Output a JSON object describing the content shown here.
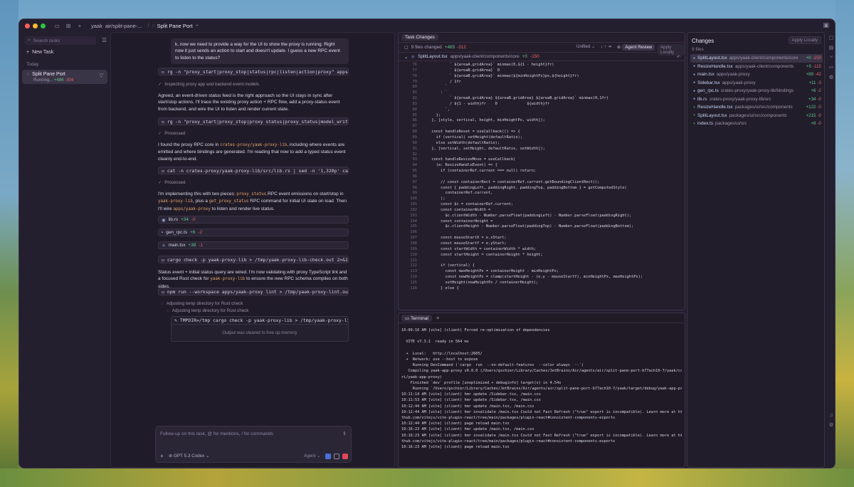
{
  "titlebar": {
    "project": "yaak",
    "branch": "air/split-pane-...",
    "sep": "/",
    "task_title": "Split Pane Port"
  },
  "sidebar": {
    "search_placeholder": "Search tasks",
    "new_task": "New Task",
    "section": "Today",
    "task": {
      "title": "Split Pane Port",
      "status": "Running...",
      "additions": "+486",
      "deletions": "-304"
    }
  },
  "chat": {
    "user_message": "k, now we need to provide a way for the UI to show the proxy is running. Right now it just sends an action to start and doesn't update. I guess a new RPC event to listen to the status?",
    "cmd1": "rg -n \"proxy_start|proxy_stop|status|rpc|listen|action|proxy\" apps/yaak-proxy -g \"!*.ts...",
    "status1": "Inspecting proxy app and backend event models",
    "para1": "Agreed, an event-driven status feed is the right approach so the UI stays in sync after start/stop actions. I'll trace the existing proxy action + RPC flow, add a proxy-status event from backend, and wire the UI to listen and render current state.",
    "cmd2": "rg -n \"proxy_start|proxy_stop|proxy status|proxy_status|model_write|emit|listen|rpc\" ...",
    "status2": "Processed",
    "para2_a": "I found the proxy RPC core in ",
    "para2_code": "crates-proxy/yaak-proxy-lib",
    "para2_b": ", including where events are emitted and where bindings are generated. I'm reading that now to add a typed status event cleanly end-to-end.",
    "cmd3": "cat -n crates-proxy/yaak-proxy-lib/src/lib.rs | sed -n '1,320p' cat -n crates-proxy/ya...",
    "status3": "Processed",
    "para3_a": "I'm implementing this with two pieces: ",
    "para3_code1": "proxy_status",
    "para3_b": " RPC event emissions on start/stop in ",
    "para3_code2": "yaak-proxy-lib",
    "para3_c": ", plus a ",
    "para3_code3": "get_proxy_status",
    "para3_d": " RPC command for initial UI state on load. Then I'll wire ",
    "para3_code4": "apps/yaak-proxy",
    "para3_e": " to listen and render live status.",
    "files": [
      {
        "name": "lib.rs",
        "add": "+34",
        "del": "-0"
      },
      {
        "name": "gen_rpc.ts",
        "add": "+6",
        "del": "-2"
      },
      {
        "name": "main.tsx",
        "add": "+38",
        "del": "-1"
      }
    ],
    "cmd4": "cargo check -p yaak-proxy-lib > /tmp/yaak-proxy-lib-check.out 2>&1; echo exit:$?; s...",
    "para4_a": "Status event + initial status query are wired. I'm now validating with proxy TypeScript lint and a focused Rust check for ",
    "para4_code": "yaak-proxy-lib",
    "para4_b": " to ensure the new RPC schema compiles on both sides.",
    "cmd5": "npm run --workspace apps/yaak-proxy lint > /tmp/yaak-proxy-lint.out 2>&1; echo exi...",
    "spin1": "Adjusting temp directory for Rust check",
    "spin2": "Adjusting temp directory for Rust check",
    "output_cmd": "TMPDIR=/tmp cargo check -p yaak-proxy-lib > /tmp/yaak-proxy-lib-check.out...",
    "output_msg": "Output was cleared to free up memory",
    "composer_placeholder": "Follow-up on this task, @ for mentions, / for commands",
    "model": "GPT 5.3 Codex",
    "mode": "Agent"
  },
  "task_changes": {
    "tab": "Task Changes",
    "files_changed": "9 files changed",
    "additions": "+485",
    "deletions": "-312",
    "view": "Unified",
    "agent_review": "Agent Review",
    "apply_locally": "Apply Locally",
    "file": "SplitLayout.tsx",
    "file_path": "apps/yaak-client/components/core",
    "file_add": "+0",
    "file_del": "-150",
    "code": [
      {
        "ln": "76",
        "tx": "          ` ${areaA.gridArea}` minmax(0,${1 - height}fr)"
      },
      {
        "ln": "77",
        "tx": "          ` ${areaB.gridArea}` 0"
      },
      {
        "ln": "78",
        "tx": "          ` ${areaB.gridArea}` minmax(${minHeightPx}px,${height}fr)"
      },
      {
        "ln": "79",
        "tx": "          / 1fr"
      },
      {
        "ln": "80",
        "tx": "        `"
      },
      {
        "ln": "81",
        "tx": "      : `"
      },
      {
        "ln": "82",
        "tx": "          ` ${areaA.gridArea} ${areaB.gridArea} ${areaB.gridArea}` minmax(0,1fr)"
      },
      {
        "ln": "83",
        "tx": "          / ${1 - width}fr    0             ${width}fr"
      },
      {
        "ln": "84",
        "tx": "        `,"
      },
      {
        "ln": "85",
        "tx": "    };"
      },
      {
        "ln": "86",
        "tx": "  }, [style, vertical, height, minHeightPx, width]);"
      },
      {
        "ln": "87",
        "tx": ""
      },
      {
        "ln": "88",
        "tx": "  const handleReset = useCallback(() => {"
      },
      {
        "ln": "89",
        "tx": "    if (vertical) setHeight(defaultRatio);"
      },
      {
        "ln": "90",
        "tx": "    else setWidth(defaultRatio);"
      },
      {
        "ln": "91",
        "tx": "  }, [vertical, setHeight, defaultRatio, setWidth]);"
      },
      {
        "ln": "92",
        "tx": ""
      },
      {
        "ln": "93",
        "tx": "  const handleResizeMove = useCallback("
      },
      {
        "ln": "94",
        "tx": "    (e: ResizeHandleEvent) => {"
      },
      {
        "ln": "95",
        "tx": "      if (containerRef.current === null) return;"
      },
      {
        "ln": "96",
        "tx": ""
      },
      {
        "ln": "97",
        "tx": "      // const containerRect = containerRef.current.getBoundingClientRect();"
      },
      {
        "ln": "98",
        "tx": "      const { paddingLeft, paddingRight, paddingTop, paddingBottom } = getComputedStyle("
      },
      {
        "ln": "99",
        "tx": "        containerRef.current,"
      },
      {
        "ln": "100",
        "tx": "      );"
      },
      {
        "ln": "101",
        "tx": "      const $c = containerRef.current;"
      },
      {
        "ln": "102",
        "tx": "      const containerWidth ="
      },
      {
        "ln": "103",
        "tx": "        $c.clientWidth - Number.parseFloat(paddingLeft) - Number.parseFloat(paddingRight);"
      },
      {
        "ln": "104",
        "tx": "      const containerHeight ="
      },
      {
        "ln": "105",
        "tx": "        $c.clientHeight - Number.parseFloat(paddingTop) - Number.parseFloat(paddingBottom);"
      },
      {
        "ln": "106",
        "tx": ""
      },
      {
        "ln": "107",
        "tx": "      const mouseStartX = e.xStart;"
      },
      {
        "ln": "108",
        "tx": "      const mouseStartY = e.yStart;"
      },
      {
        "ln": "109",
        "tx": "      const startWidth = containerWidth * width;"
      },
      {
        "ln": "110",
        "tx": "      const startHeight = containerHeight * height;"
      },
      {
        "ln": "111",
        "tx": ""
      },
      {
        "ln": "112",
        "tx": "      if (vertical) {"
      },
      {
        "ln": "113",
        "tx": "        const maxHeightPx = containerHeight - minHeightPx;"
      },
      {
        "ln": "114",
        "tx": "        const newHeightPx = clamp(startHeight - (e.y - mouseStartY), minHeightPx, maxHeightPx);"
      },
      {
        "ln": "115",
        "tx": "        setHeight(newHeightPx / containerHeight);"
      },
      {
        "ln": "116",
        "tx": "      } else {"
      }
    ]
  },
  "terminal": {
    "tab": "Terminal",
    "add": "+",
    "lines": [
      "10:09:10 AM [vite] (client) Forced re-optimization of dependencies",
      "",
      "  VITE v7.3.1  ready in 564 ms",
      "",
      "  ➜  Local:   http://localhost:2605/",
      "  ➜  Network: use --host to expose",
      "     Running DevCommand (`cargo  run  --no-default-features  --color always  --`)",
      "   Compiling yaak-app-proxy v0.0.0 (/Users/gschier/Library/Caches/JetBrains/Air/agents/air/split-pane-port-b77ach10-7/yaak/crates-tau",
      "ri/yaak-app-proxy)",
      "    Finished `dev` profile [unoptimized + debuginfo] target(s) in 4.54s",
      "     Running `/Users/gschier/Library/Caches/JetBrains/Air/agents/air/split-pane-port-b77ach10-7/yaak/target/debug/yaak-app-proxy`",
      "10:11:14 AM [vite] (client) hmr update /Sidebar.tsx, /main.css",
      "10:11:53 AM [vite] (client) hmr update /Sidebar.tsx, /main.css",
      "10:12:44 AM [vite] (client) hmr update /main.tsx, /main.css",
      "10:12:44 AM [vite] (client) hmr invalidate /main.tsx Could not Fast Refresh (\"true\" export is incompatible). Learn more at https://gi",
      "thub.com/vitejs/vite-plugin-react/tree/main/packages/plugin-react#consistent-components-exports",
      "10:12:44 AM [vite] (client) page reload main.tsx",
      "10:16:23 AM [vite] (client) hmr update /main.tsx, /main.css",
      "10:16:23 AM [vite] (client) hmr invalidate /main.tsx Could not Fast Refresh (\"true\" export is incompatible). Learn more at https://gi",
      "thub.com/vitejs/vite-plugin-react/tree/main/packages/plugin-react#consistent-components-exports",
      "10:16:23 AM [vite] (client) page reload main.tsx"
    ]
  },
  "changes": {
    "title": "Changes",
    "apply": "Apply Locally",
    "count": "9 files",
    "items": [
      {
        "name": "SplitLayout.tsx",
        "path": "apps/yaak-client/components/core",
        "add": "+0",
        "del": "-150"
      },
      {
        "name": "ResizeHandle.tsx",
        "path": "apps/yaak-client/components",
        "add": "+0",
        "del": "-115"
      },
      {
        "name": "main.tsx",
        "path": "apps/yaak-proxy",
        "add": "+89",
        "del": "-42"
      },
      {
        "name": "Sidebar.tsx",
        "path": "apps/yaak-proxy",
        "add": "+11",
        "del": "-3"
      },
      {
        "name": "gen_rpc.ts",
        "path": "crates-proxy/yaak-proxy-lib/bindings",
        "add": "+6",
        "del": "-2"
      },
      {
        "name": "lib.rs",
        "path": "crates-proxy/yaak-proxy-lib/src",
        "add": "+34",
        "del": "-0"
      },
      {
        "name": "ResizeHandle.tsx",
        "path": "packages/ui/src/components",
        "add": "+122",
        "del": "-0"
      },
      {
        "name": "SplitLayout.tsx",
        "path": "packages/ui/src/components",
        "add": "+215",
        "del": "-0"
      },
      {
        "name": "index.ts",
        "path": "packages/ui/src",
        "add": "+8",
        "del": "-0"
      }
    ]
  }
}
